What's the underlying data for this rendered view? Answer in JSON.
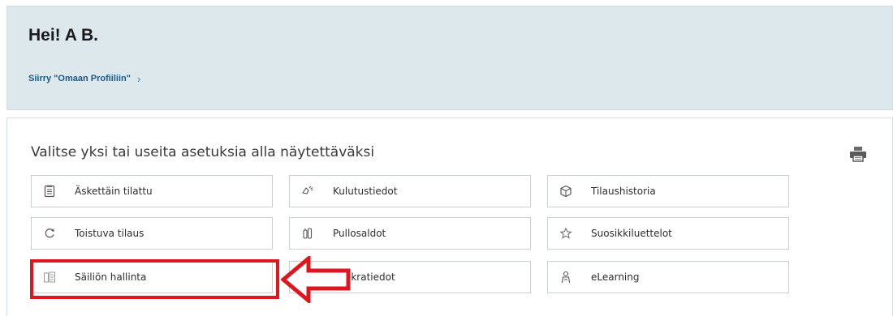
{
  "header": {
    "greeting": "Hei! A B.",
    "profile_link": "Siirry \"Omaan Profiiliin\"",
    "profile_chevron": "›"
  },
  "options": {
    "heading": "Valitse yksi tai useita asetuksia alla näytettäväksi",
    "print_icon": "printer-icon",
    "tiles": [
      {
        "label": "Äskettäin tilattu",
        "icon": "clipboard-list-icon"
      },
      {
        "label": "Kulutustiedot",
        "icon": "gas-flow-icon"
      },
      {
        "label": "Tilaushistoria",
        "icon": "box-icon"
      },
      {
        "label": "Toistuva tilaus",
        "icon": "refresh-icon"
      },
      {
        "label": "Pullosaldot",
        "icon": "cylinders-icon"
      },
      {
        "label": "Suosikkiluettelot",
        "icon": "star-icon"
      },
      {
        "label": "Säiliön hallinta",
        "icon": "tank-icon"
      },
      {
        "label": "Vuokratiedot",
        "icon": "chart-icon"
      },
      {
        "label": "eLearning",
        "icon": "person-icon"
      }
    ]
  },
  "annotation": {
    "highlight_color": "#e0161e"
  },
  "colors": {
    "header_bg": "#dde8ed",
    "link": "#1b5a86",
    "chevron": "#2a87c8"
  }
}
